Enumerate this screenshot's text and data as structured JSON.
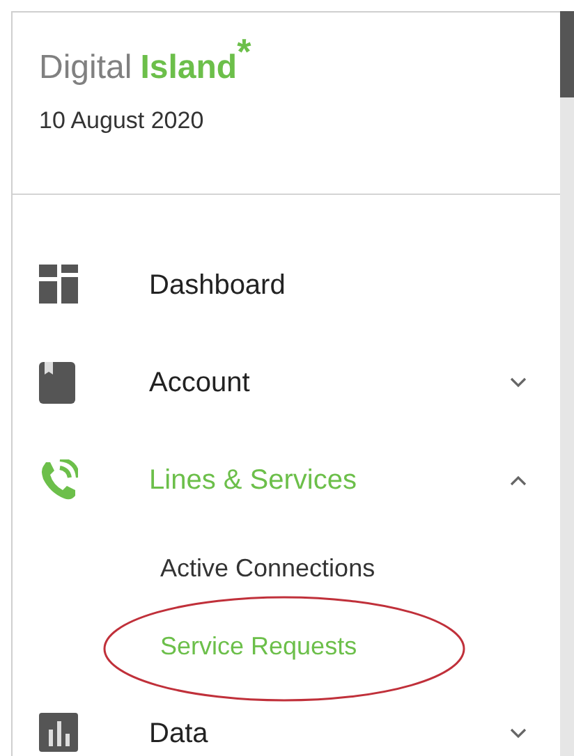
{
  "logo": {
    "word_1": "Digital",
    "word_2": "Island",
    "mark": "*"
  },
  "date": "10 August 2020",
  "menu": [
    {
      "label": "Dashboard",
      "kind": "dashboard",
      "selected": false
    },
    {
      "label": "Account",
      "kind": "account",
      "selected": false,
      "expanded": false
    },
    {
      "label": "Lines & Services",
      "kind": "phone",
      "selected": true,
      "expanded": true,
      "children": [
        {
          "label": "Active Connections",
          "selected": false,
          "circled": false
        },
        {
          "label": "Service Requests",
          "selected": true,
          "circled": true
        }
      ]
    },
    {
      "label": "Data",
      "kind": "data",
      "selected": false,
      "expanded": false
    }
  ]
}
